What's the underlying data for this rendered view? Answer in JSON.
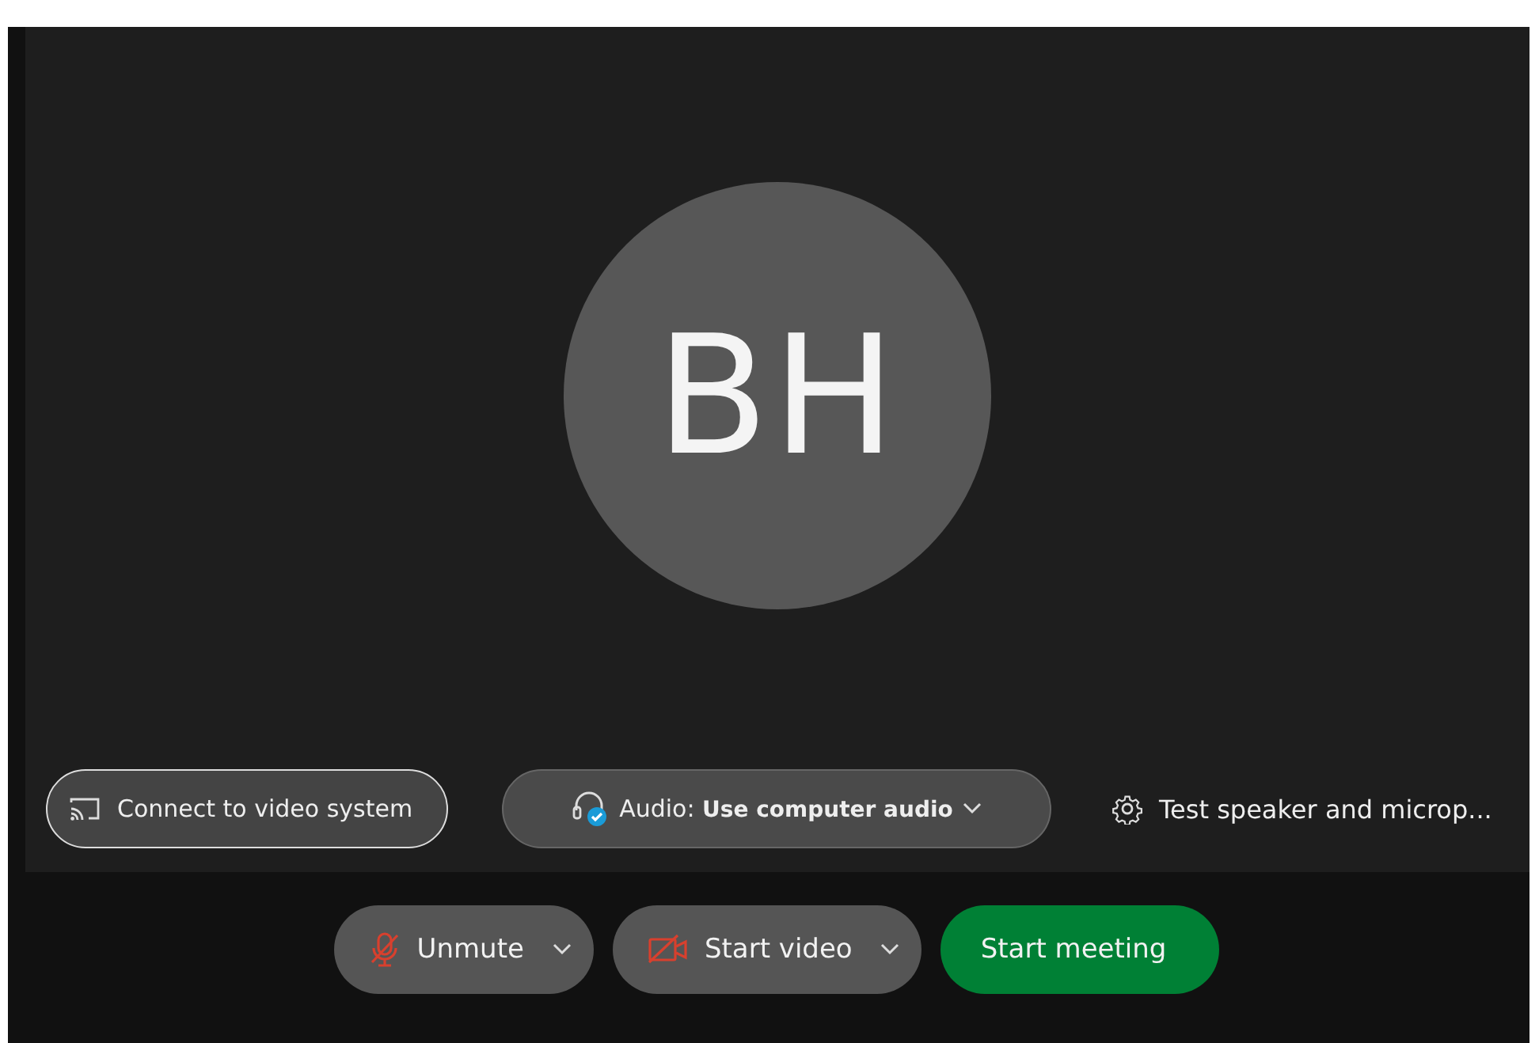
{
  "preview": {
    "avatar": {
      "initials": "BH"
    },
    "connect_button": {
      "label": "Connect to video system"
    },
    "audio_button": {
      "label": "Audio: **Use computer audio**"
    },
    "test_link": {
      "label": "Test speaker and microp..."
    }
  },
  "controls": [
    {
      "kind": "mic",
      "label": "Unmute",
      "off": true,
      "has_menu": true
    },
    {
      "kind": "camera",
      "label": "Start video",
      "off": true,
      "has_menu": true
    },
    {
      "kind": "start",
      "label": "Start meeting",
      "has_menu": false
    }
  ]
}
